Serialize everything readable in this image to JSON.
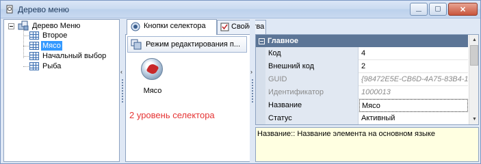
{
  "window": {
    "title": "Дерево меню",
    "minimize_glyph": "—",
    "maximize_glyph": "☐",
    "close_glyph": "✕"
  },
  "tree": {
    "root": "Дерево Меню",
    "items": [
      {
        "label": "Второе",
        "selected": false
      },
      {
        "label": "Мясо",
        "selected": true
      },
      {
        "label": "Начальный выбор",
        "selected": false
      },
      {
        "label": "Рыба",
        "selected": false
      }
    ]
  },
  "tabs": [
    {
      "label": "Кнопки селектора",
      "active": true,
      "icon": "selector-buttons-icon"
    },
    {
      "label": "Свойства",
      "active": false,
      "icon": "properties-check-icon"
    }
  ],
  "selector": {
    "mode_button": "Режим редактирования п...",
    "item_caption": "Мясо",
    "level_text": "2 уровень селектора",
    "level_color": "#e53333"
  },
  "splitter_arrows": {
    "left": "‹",
    "right": "›"
  },
  "properties": {
    "category": "Главное",
    "rows": [
      {
        "name": "Код",
        "value": "4",
        "readonly": false
      },
      {
        "name": "Внешний код",
        "value": "2",
        "readonly": false
      },
      {
        "name": "GUID",
        "value": "{98472E5E-CB6D-4A75-83B4-1",
        "readonly": true
      },
      {
        "name": "Идентификатор",
        "value": "1000013",
        "readonly": true
      },
      {
        "name": "Название",
        "value": "Мясо",
        "readonly": false
      },
      {
        "name": "Статус",
        "value": "Активный",
        "readonly": false
      }
    ]
  },
  "help": {
    "text": "Название:: Название элемента на основном языке"
  },
  "colors": {
    "selection": "#3399ff",
    "category_header": "#5c7596",
    "help_background": "#ffffe1"
  }
}
